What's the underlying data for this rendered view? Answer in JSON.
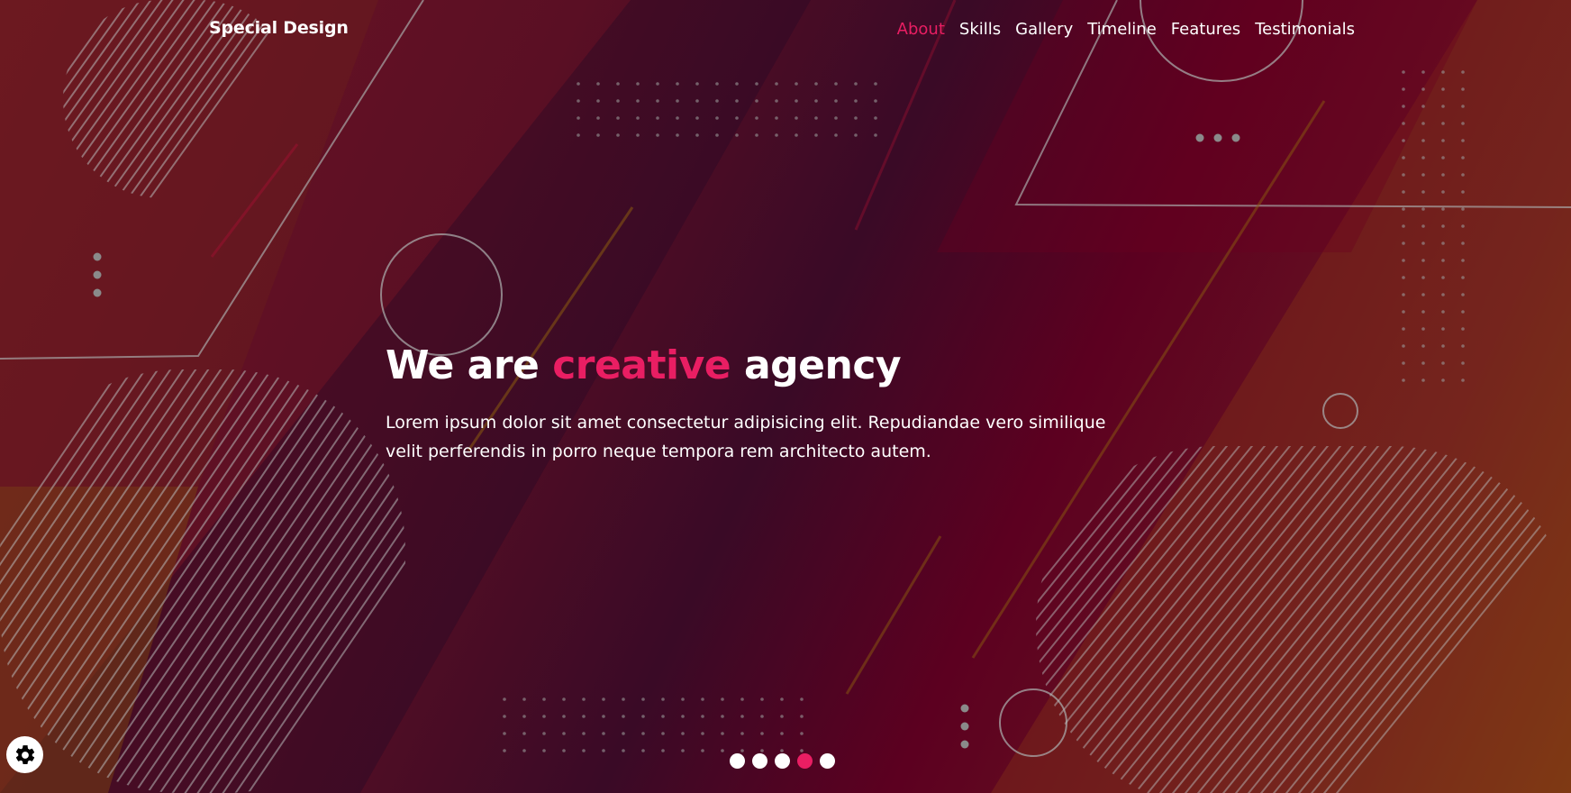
{
  "header": {
    "logo": "Special Design",
    "nav": [
      {
        "label": "About",
        "active": true
      },
      {
        "label": "Skills",
        "active": false
      },
      {
        "label": "Gallery",
        "active": false
      },
      {
        "label": "Timeline",
        "active": false
      },
      {
        "label": "Features",
        "active": false
      },
      {
        "label": "Testimonials",
        "active": false
      }
    ]
  },
  "hero": {
    "headline_prefix": "We are",
    "headline_accent": "creative",
    "headline_suffix": "agency",
    "description": "Lorem ipsum dolor sit amet consectetur adipisicing elit. Repudiandae vero similique velit perferendis in porro neque tempora rem architecto autem."
  },
  "slider": {
    "bullet_count": 5,
    "active_index": 3
  },
  "settings": {
    "icon": "gear-icon"
  },
  "colors": {
    "accent": "#e91e63",
    "text": "#ffffff"
  }
}
